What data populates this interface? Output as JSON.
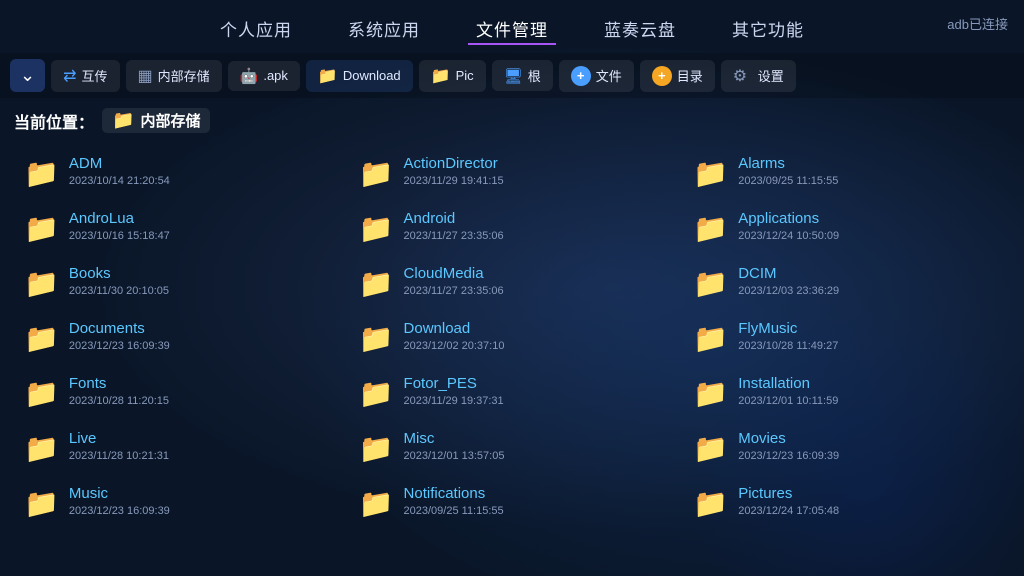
{
  "adb_status": "adb已连接",
  "nav": {
    "items": [
      {
        "label": "个人应用",
        "active": false
      },
      {
        "label": "系统应用",
        "active": false
      },
      {
        "label": "文件管理",
        "active": true
      },
      {
        "label": "蓝奏云盘",
        "active": false
      },
      {
        "label": "其它功能",
        "active": false
      }
    ]
  },
  "toolbar": {
    "collapse_icon": "⌄",
    "buttons": [
      {
        "label": "互传",
        "icon": "share",
        "type": "share"
      },
      {
        "label": "内部存储",
        "icon": "storage",
        "type": "storage"
      },
      {
        "label": ".apk",
        "icon": "android",
        "type": "apk"
      },
      {
        "label": "Download",
        "icon": "folder",
        "type": "folder"
      },
      {
        "label": "Pic",
        "icon": "folder",
        "type": "folder"
      },
      {
        "label": "根",
        "icon": "monitor",
        "type": "root"
      },
      {
        "label": "文件",
        "icon": "plus-blue",
        "type": "new-file"
      },
      {
        "label": "目录",
        "icon": "plus-orange",
        "type": "new-dir"
      },
      {
        "label": "设置",
        "icon": "gear",
        "type": "settings"
      }
    ]
  },
  "breadcrumb": {
    "prefix": "当前位置：",
    "folder_icon": "📁",
    "folder_name": "内部存储"
  },
  "files": [
    {
      "col": 0,
      "items": [
        {
          "name": "ADM",
          "date": "2023/10/14 21:20:54"
        },
        {
          "name": "AndroLua",
          "date": "2023/10/16 15:18:47"
        },
        {
          "name": "Books",
          "date": "2023/11/30 20:10:05"
        },
        {
          "name": "Documents",
          "date": "2023/12/23 16:09:39"
        },
        {
          "name": "Fonts",
          "date": "2023/10/28 11:20:15"
        },
        {
          "name": "Live",
          "date": "2023/11/28 10:21:31"
        },
        {
          "name": "Music",
          "date": "2023/12/23 16:09:39"
        }
      ]
    },
    {
      "col": 1,
      "items": [
        {
          "name": "ActionDirector",
          "date": "2023/11/29 19:41:15"
        },
        {
          "name": "Android",
          "date": "2023/11/27 23:35:06"
        },
        {
          "name": "CloudMedia",
          "date": "2023/11/27 23:35:06"
        },
        {
          "name": "Download",
          "date": "2023/12/02 20:37:10"
        },
        {
          "name": "Fotor_PES",
          "date": "2023/11/29 19:37:31"
        },
        {
          "name": "Misc",
          "date": "2023/12/01 13:57:05"
        },
        {
          "name": "Notifications",
          "date": "2023/09/25 11:15:55"
        }
      ]
    },
    {
      "col": 2,
      "items": [
        {
          "name": "Alarms",
          "date": "2023/09/25 11:15:55"
        },
        {
          "name": "Applications",
          "date": "2023/12/24 10:50:09"
        },
        {
          "name": "DCIM",
          "date": "2023/12/03 23:36:29"
        },
        {
          "name": "FlyMusic",
          "date": "2023/10/28 11:49:27"
        },
        {
          "name": "Installation",
          "date": "2023/12/01 10:11:59"
        },
        {
          "name": "Movies",
          "date": "2023/12/23 16:09:39"
        },
        {
          "name": "Pictures",
          "date": "2023/12/24 17:05:48"
        }
      ]
    }
  ]
}
